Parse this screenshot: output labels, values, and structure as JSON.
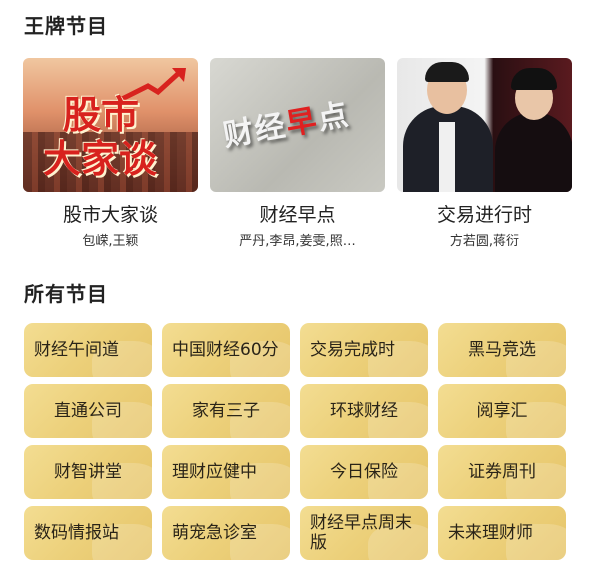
{
  "sections": {
    "featured_title": "王牌节目",
    "all_title": "所有节目"
  },
  "featured": [
    {
      "name": "股市大家谈",
      "hosts": "包嵘,王颖",
      "thumb_text": [
        "股市",
        "大家谈"
      ]
    },
    {
      "name": "财经早点",
      "hosts": "严丹,李昂,姜雯,照…",
      "thumb_text": [
        "财经",
        "早",
        "点"
      ]
    },
    {
      "name": "交易进行时",
      "hosts": "方若圆,蒋衍"
    }
  ],
  "programs": [
    "财经午间道",
    "中国财经60分",
    "交易完成时",
    "黑马竞选",
    "直通公司",
    "家有三子",
    "环球财经",
    "阅享汇",
    "财智讲堂",
    "理财应健中",
    "今日保险",
    "证券周刊",
    "数码情报站",
    "萌宠急诊室",
    "财经早点周末版",
    "未来理财师"
  ],
  "colors": {
    "tile": "#ecd07a",
    "accent_red": "#d8221e"
  }
}
